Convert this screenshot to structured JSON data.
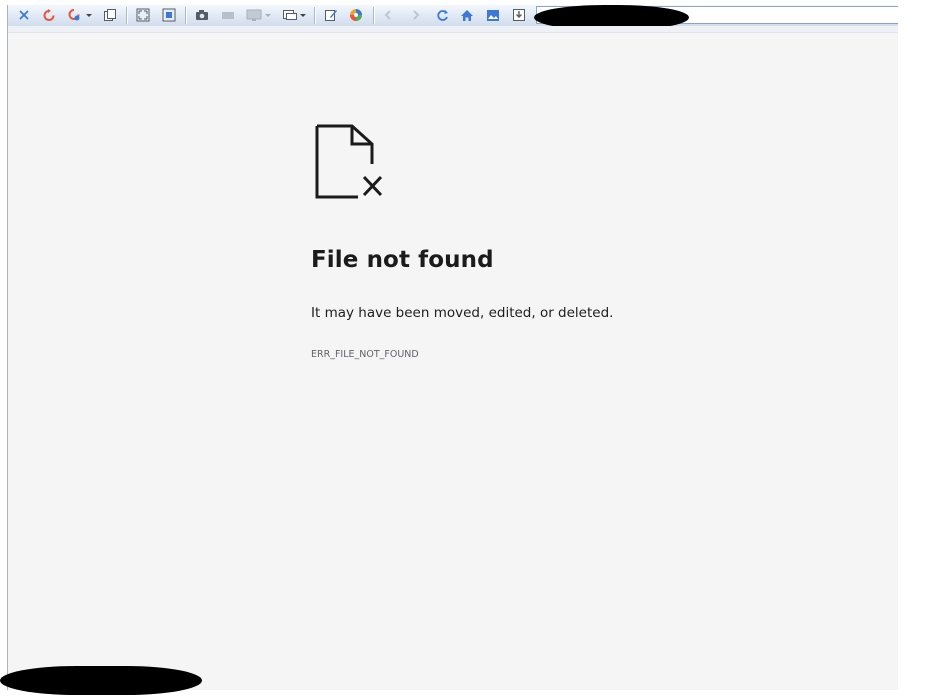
{
  "toolbar": {
    "buttons": [
      {
        "name": "close-icon",
        "color": "#3c78d8"
      },
      {
        "name": "refresh-icon",
        "color": "#e8543a"
      },
      {
        "name": "reload-dropdown-icon",
        "color": "#e8543a"
      },
      {
        "name": "copy-icon",
        "color": "#555c66"
      },
      {
        "name": "fullscreen-icon",
        "color": "#555c66"
      },
      {
        "name": "fit-window-icon",
        "color": "#555c66"
      },
      {
        "name": "camera-icon",
        "color": "#555c66"
      },
      {
        "name": "video-icon",
        "color": "#b8bfca"
      },
      {
        "name": "monitor-icon",
        "color": "#b8bfca"
      },
      {
        "name": "window-layout-icon",
        "color": "#555c66"
      },
      {
        "name": "edit-icon",
        "color": "#3c78d8"
      },
      {
        "name": "color-wheel-icon",
        "color": "#e8a33a"
      },
      {
        "name": "back-icon",
        "color": "#b8bfca"
      },
      {
        "name": "forward-icon",
        "color": "#b8bfca"
      },
      {
        "name": "reload-page-icon",
        "color": "#3c78d8"
      },
      {
        "name": "home-icon",
        "color": "#3c78d8"
      },
      {
        "name": "image-icon",
        "color": "#3c78d8"
      },
      {
        "name": "download-icon",
        "color": "#555c66"
      }
    ],
    "address": ""
  },
  "error": {
    "icon": "file-missing-icon",
    "title": "File not found",
    "description": "It may have been moved, edited, or deleted.",
    "code": "ERR_FILE_NOT_FOUND"
  },
  "colors": {
    "page_background": "#f5f5f5",
    "title_text": "#1b1b1b",
    "code_text": "#5f6368"
  }
}
